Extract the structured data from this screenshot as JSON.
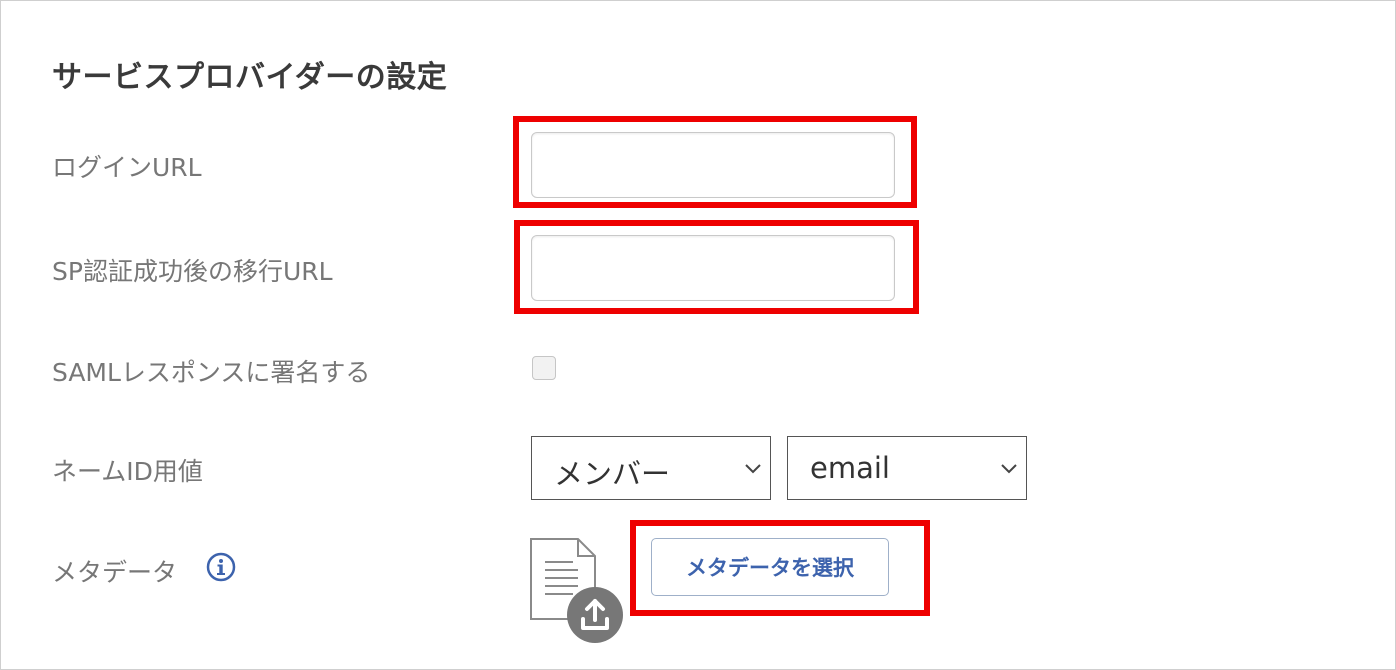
{
  "section": {
    "title": "サービスプロバイダーの設定"
  },
  "fields": {
    "login_url": {
      "label": "ログインURL",
      "value": ""
    },
    "sp_redirect_url": {
      "label": "SP認証成功後の移行URL",
      "value": ""
    },
    "sign_saml": {
      "label": "SAMLレスポンスに署名する",
      "checked": false
    },
    "name_id": {
      "label": "ネームID用値",
      "source_select": "メンバー",
      "attribute_select": "email"
    },
    "metadata": {
      "label": "メタデータ",
      "button_label": "メタデータを選択"
    }
  },
  "icons": {
    "info": "info-icon",
    "document": "document-icon",
    "upload": "upload-icon",
    "chevron": "chevron-down-icon"
  },
  "colors": {
    "highlight": "#ee0000",
    "button_text": "#3d63ad",
    "info_icon": "#3d63ad",
    "upload_badge": "#777777"
  }
}
